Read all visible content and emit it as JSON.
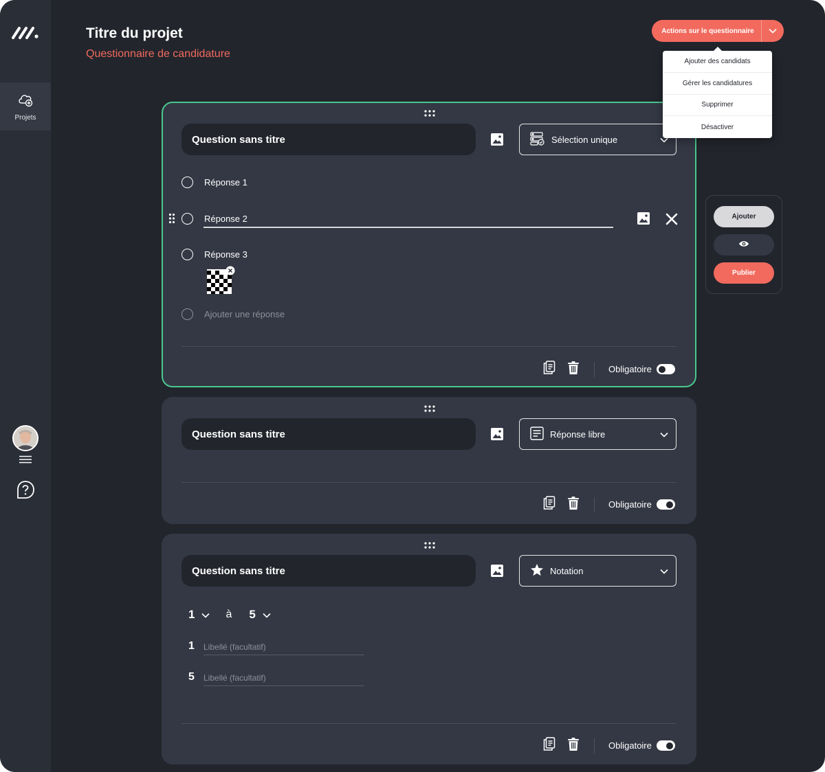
{
  "sidebar": {
    "nav_items": [
      {
        "label": "Projets",
        "icon": "project-icon"
      }
    ],
    "bottom_icons": [
      "avatar",
      "menu-icon",
      "help-icon"
    ]
  },
  "header": {
    "title": "Titre du projet",
    "subtitle": "Questionnaire de candidature",
    "actions_label": "Actions sur le questionnaire"
  },
  "actions_menu": {
    "items": [
      "Ajouter des candidats",
      "Gérer les candidatures",
      "Supprimer",
      "Désactiver"
    ]
  },
  "questions": [
    {
      "title": "Question sans titre",
      "type_label": "Sélection unique",
      "type_icon": "single-choice-icon",
      "answers": [
        "Réponse 1",
        "Réponse 2",
        "Réponse 3"
      ],
      "add_answer_placeholder": "Ajouter une réponse",
      "required_label": "Obligatoire",
      "required": false
    },
    {
      "title": "Question sans titre",
      "type_label": "Réponse libre",
      "type_icon": "free-text-icon",
      "required_label": "Obligatoire",
      "required": true
    },
    {
      "title": "Question sans titre",
      "type_label": "Notation",
      "type_icon": "star-icon",
      "range_from": "1",
      "range_sep": "à",
      "range_to": "5",
      "labels": [
        {
          "num": "1",
          "placeholder": "Libellé (facultatif)"
        },
        {
          "num": "5",
          "placeholder": "Libellé (facultatif)"
        }
      ],
      "required_label": "Obligatoire",
      "required": true
    }
  ],
  "right_panel": {
    "add_label": "Ajouter",
    "publish_label": "Publier"
  },
  "colors": {
    "accent": "#f26a5e",
    "active_border": "#49c98e",
    "background": "#22252c",
    "card": "#343844"
  }
}
